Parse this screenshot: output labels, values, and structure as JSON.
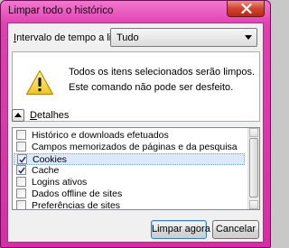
{
  "window": {
    "title": "Limpar todo o histórico"
  },
  "time_range": {
    "label_underlined": "I",
    "label_rest": "ntervalo de tempo a limpar:",
    "selected": "Tudo"
  },
  "warning": {
    "line1": "Todos os itens selecionados serão limpos.",
    "line2": "Este comando não pode ser desfeito."
  },
  "details": {
    "label_underlined": "D",
    "label_rest": "etalhes",
    "expanded": true
  },
  "items": [
    {
      "label": "Histórico e downloads efetuados",
      "checked": false
    },
    {
      "label": "Campos memorizados de páginas e da pesquisa",
      "checked": false
    },
    {
      "label": "Cookies",
      "checked": true,
      "selected": true
    },
    {
      "label": "Cache",
      "checked": true
    },
    {
      "label": "Logins ativos",
      "checked": false
    },
    {
      "label": "Dados offline de sites",
      "checked": false
    },
    {
      "label": "Preferências de sites",
      "checked": false
    }
  ],
  "buttons": {
    "clear": "Limpar agora",
    "cancel": "Cancelar"
  },
  "colors": {
    "frame": "#e13fb0",
    "dialog_bg": "#f0f0f0",
    "selection": "#dde9f8",
    "close_button": "#d0432e"
  },
  "icons": {
    "close": "close-icon",
    "warning": "warning-icon",
    "select_arrow": "chevron-down-icon",
    "details_toggle": "chevron-up-icon",
    "checkbox_mark": "checkmark-icon"
  }
}
